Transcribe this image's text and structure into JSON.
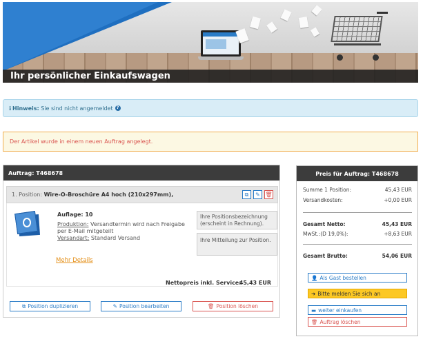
{
  "hero": {
    "title": "Ihr persönlicher Einkaufswagen"
  },
  "info": {
    "label": "Hinweis:",
    "text": "Sie sind nicht angemeldet"
  },
  "error": {
    "text": "Der Artikel wurde in einem neuen Auftrag angelegt."
  },
  "order": {
    "title": "Auftrag: T468678",
    "position": {
      "prefix": "1. Position:",
      "name": "Wire-O-Broschüre A4 hoch (210x297mm),",
      "auflage": "Auflage: 10",
      "produktion_label": "Produktion:",
      "produktion_text": "Versandtermin wird nach Freigabe per E-Mail mitgeteilt",
      "versandart_label": "Versandart:",
      "versandart_text": "Standard Versand",
      "note_positionsbezeichnung": "Ihre Positionsbezeichnung (erscheint in Rechnung).",
      "note_mitteilung": "Ihre Mitteilung zur Position.",
      "more_details": "Mehr Details",
      "net_label": "Nettopreis inkl. Service:",
      "net_value": "45,43 EUR"
    },
    "buttons": {
      "duplicate": "Position duplizieren",
      "edit": "Position bearbeiten",
      "delete": "Position löschen"
    }
  },
  "price": {
    "title": "Preis für Auftrag: T468678",
    "summe_label": "Summe 1 Position:",
    "summe_value": "45,43 EUR",
    "versand_label": "Versandkosten:",
    "versand_value": "+0,00 EUR",
    "netto_label": "Gesamt Netto:",
    "netto_value": "45,43 EUR",
    "mwst_label": "MwSt.:(D 19,0%):",
    "mwst_value": "+8,63 EUR",
    "brutto_label": "Gesamt Brutto:",
    "brutto_value": "54,06 EUR",
    "buttons": {
      "guest": "Als Gast bestellen",
      "login": "Bitte melden Sie sich an",
      "continue": "weiter einkaufen",
      "delete_order": "Auftrag löschen"
    }
  }
}
